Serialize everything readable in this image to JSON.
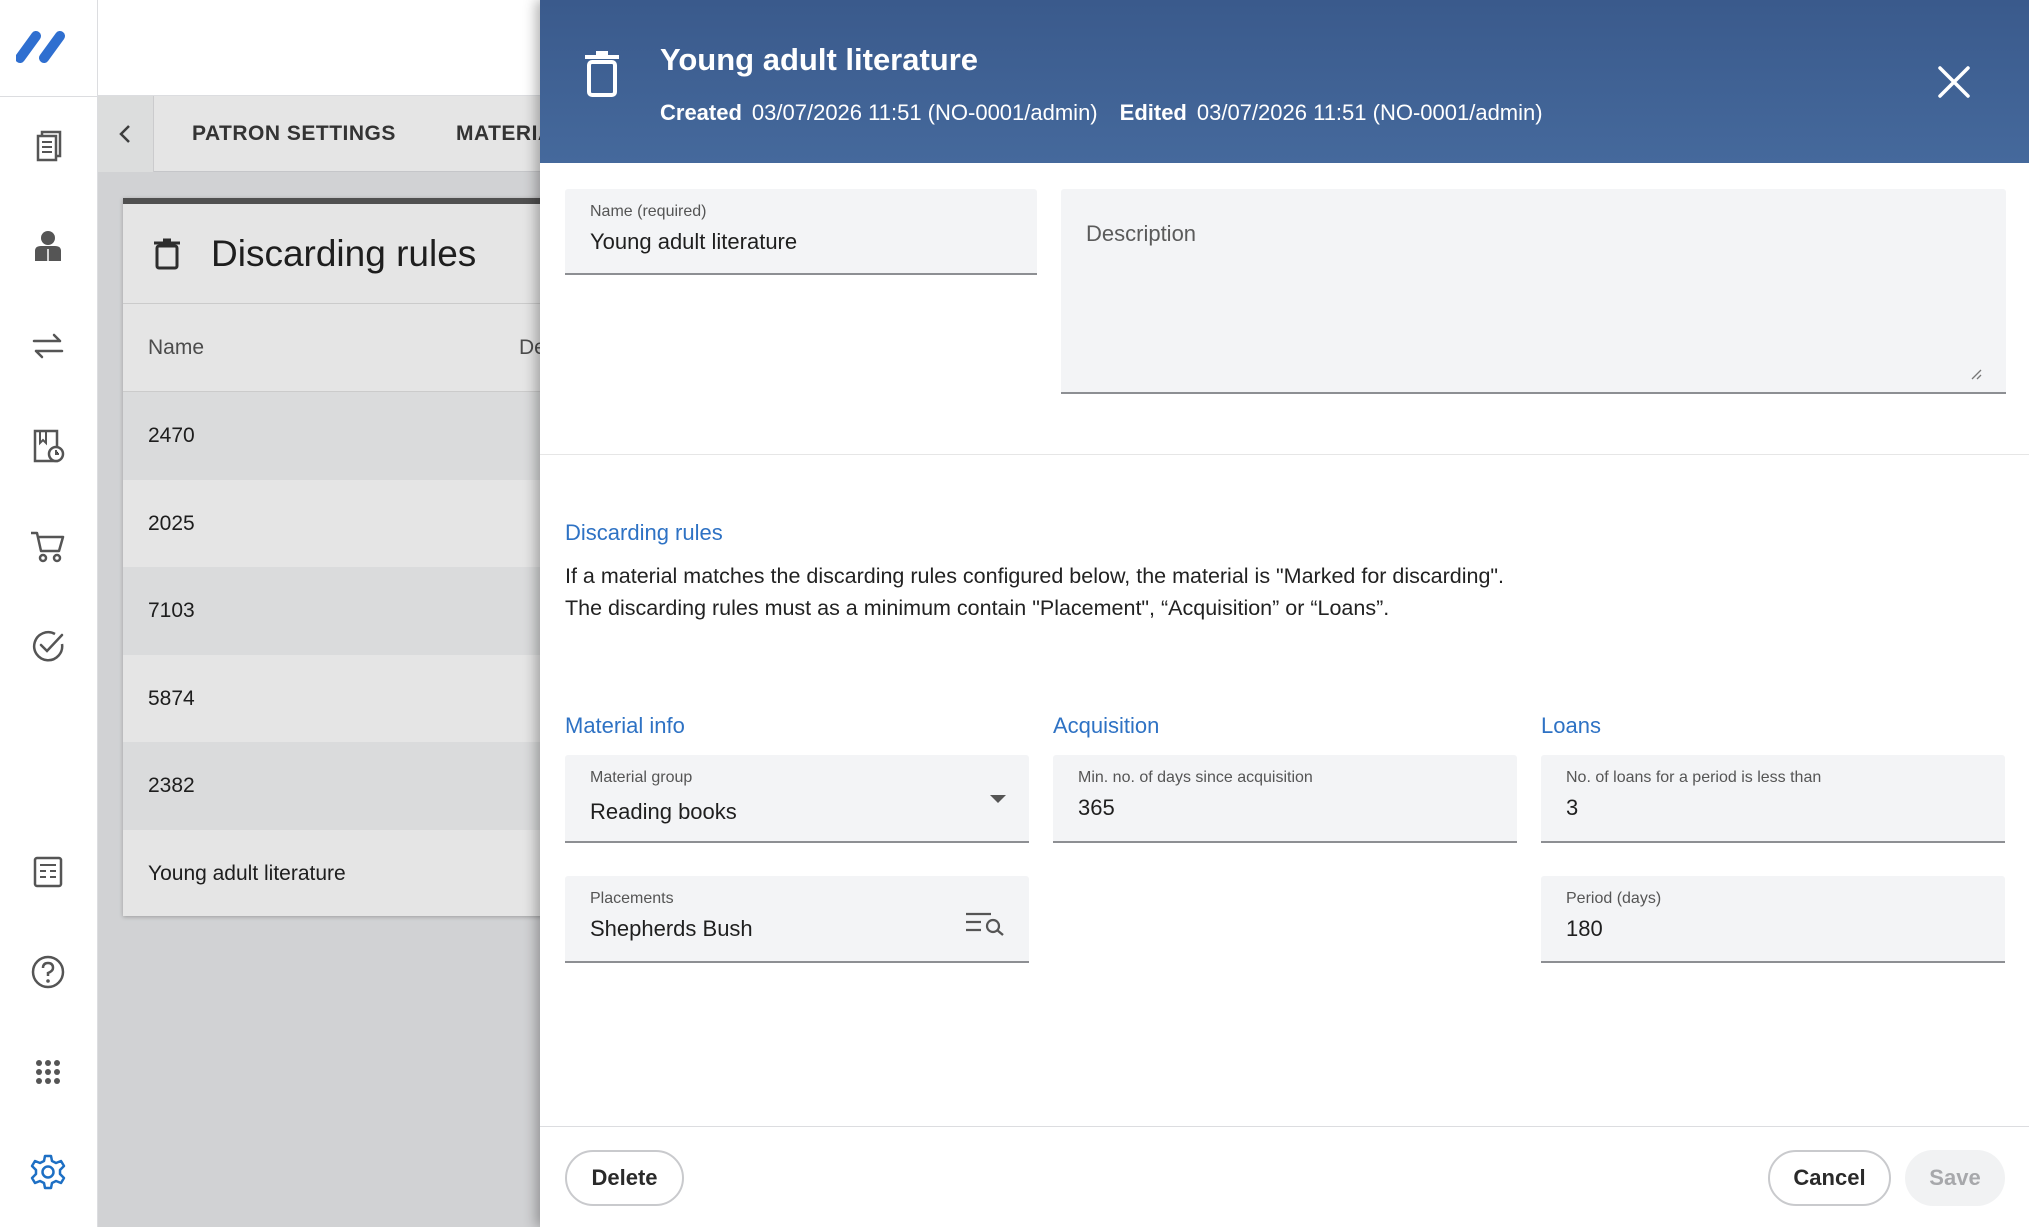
{
  "tabs": [
    "PATRON SETTINGS",
    "MATERIA"
  ],
  "card": {
    "title": "Discarding rules",
    "columns": [
      "Name",
      "De"
    ],
    "rows": [
      "2470",
      "2025",
      "7103",
      "5874",
      "2382",
      "Young adult literature"
    ]
  },
  "modal": {
    "title": "Young adult literature",
    "created_label": "Created",
    "created_value": "03/07/2026 11:51 (NO-0001/admin)",
    "edited_label": "Edited",
    "edited_value": "03/07/2026 11:51 (NO-0001/admin)",
    "name_label": "Name (required)",
    "name_value": "Young adult literature",
    "description_placeholder": "Description",
    "rules_title": "Discarding rules",
    "rules_line1": "If a material matches the discarding rules configured below, the material is \"Marked for discarding\".",
    "rules_line2": "The discarding rules must as a minimum contain \"Placement\", “Acquisition” or “Loans”.",
    "material_info_title": "Material info",
    "material_group_label": "Material group",
    "material_group_value": "Reading books",
    "placements_label": "Placements",
    "placements_value": "Shepherds Bush",
    "acquisition_title": "Acquisition",
    "min_days_label": "Min. no. of days since acquisition",
    "min_days_value": "365",
    "loans_title": "Loans",
    "loans_label": "No. of loans for a period is less than",
    "loans_value": "3",
    "period_label": "Period (days)",
    "period_value": "180",
    "delete_label": "Delete",
    "cancel_label": "Cancel",
    "save_label": "Save"
  },
  "colors": {
    "header_bg": "#3d5f92",
    "accent": "#2e72c4",
    "settings_icon": "#1d6fc4"
  },
  "icons": [
    "logo",
    "catalogue-icon",
    "patron-icon",
    "circulation-icon",
    "periodicals-icon",
    "acquisition-cart-icon",
    "approve-check-icon",
    "reports-icon",
    "help-icon",
    "apps-grid-icon",
    "settings-gear-icon"
  ]
}
